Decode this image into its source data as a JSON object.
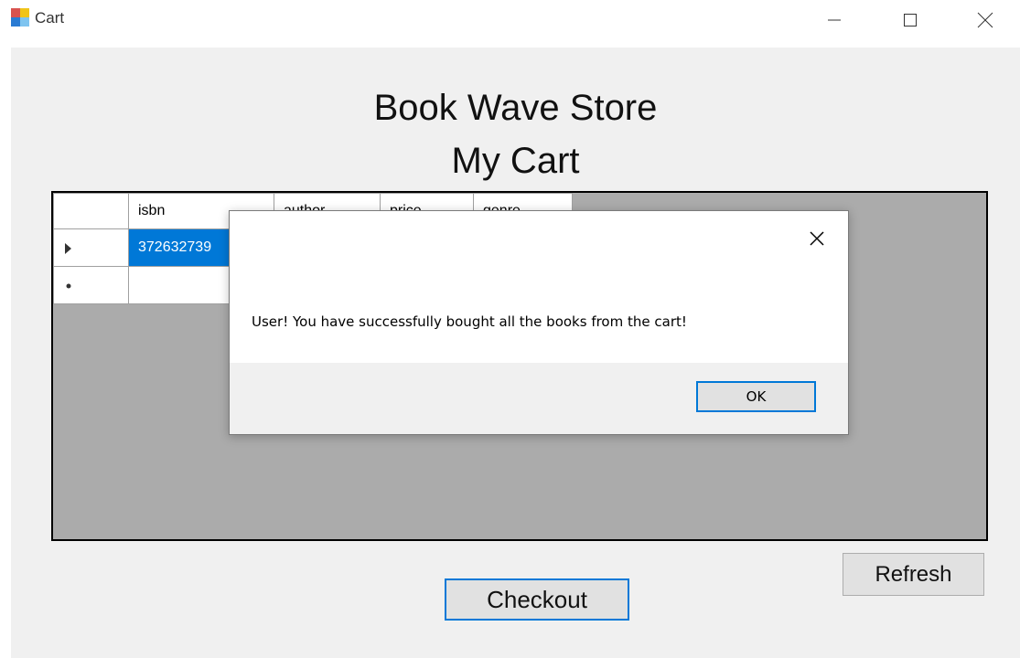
{
  "window": {
    "title": "Cart",
    "icons": {
      "app": "app-form-icon",
      "minimize": "minimize-icon",
      "maximize": "maximize-icon",
      "close": "close-icon"
    }
  },
  "header": {
    "back_icon": "chevron-left-icon",
    "store_name": "Book Wave Store",
    "page_title": "My Cart"
  },
  "grid": {
    "columns": [
      "isbn",
      "author",
      "price",
      "genre"
    ],
    "rows": [
      {
        "row_indicator": "current-row-arrow-icon",
        "cells": [
          "372632739",
          "",
          "",
          ""
        ],
        "selected_cell": 0
      },
      {
        "row_indicator": "new-row-asterisk-icon",
        "cells": [
          "",
          "",
          "",
          ""
        ]
      }
    ]
  },
  "dialog": {
    "message": "User! You have successfully bought all the books from the cart!",
    "ok_label": "OK",
    "close_icon": "close-icon"
  },
  "buttons": {
    "refresh_label": "Refresh",
    "checkout_label": "Checkout"
  },
  "colors": {
    "selection": "#0078d7",
    "focus_border": "#0078d7",
    "grid_background": "#ababab",
    "form_background": "#f0f0f0"
  }
}
